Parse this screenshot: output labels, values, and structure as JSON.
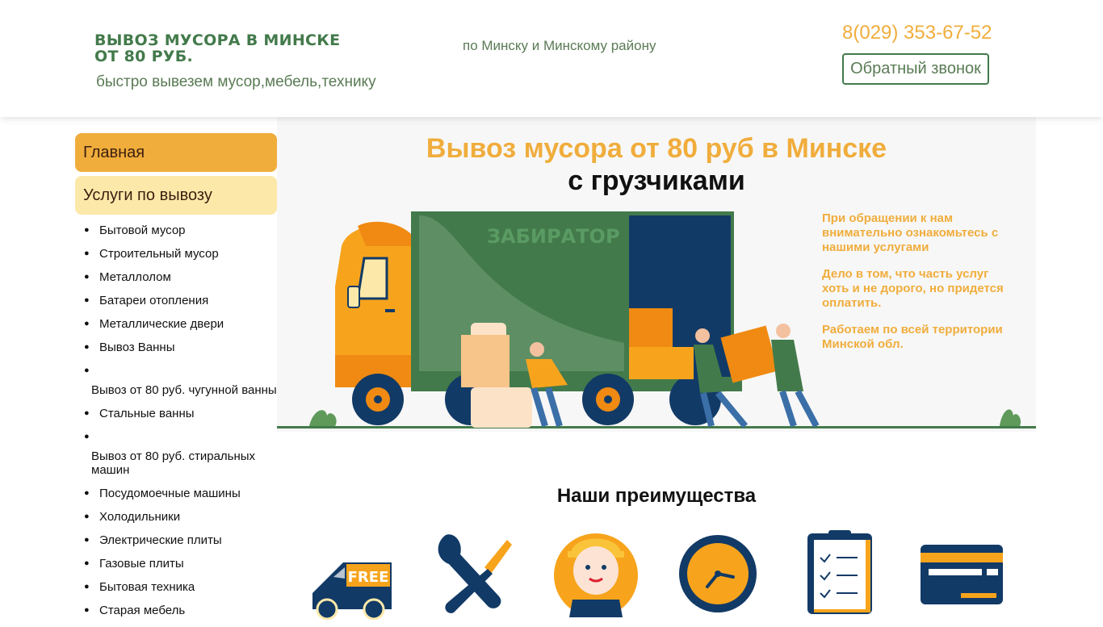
{
  "header": {
    "logo_line1": "ВЫВОЗ МУСОРА В МИНСКЕ",
    "logo_line2": "ОТ 80 РУБ.",
    "tagline": "быстро вывезем мусор,мебель,технику",
    "region": "по Минску и Минскому району",
    "phone": "8(029) 353-67-52",
    "callback_label": "Обратный звонок"
  },
  "sidebar": {
    "home_label": "Главная",
    "services_label": "Услуги по вывозу",
    "items": [
      "Бытовой мусор",
      "Строительный мусор",
      "Металлолом",
      "Батареи отопления",
      "Металлические двери",
      "Вывоз Ванны",
      "Вывоз от 80 руб. чугунной ванны",
      "Стальные ванны",
      "Вывоз от 80 руб. стиральных машин",
      "Посудомоечные машины",
      "Холодильники",
      "Электрические плиты",
      "Газовые плиты",
      "Бытовая техника",
      "Старая мебель"
    ]
  },
  "hero": {
    "title": "Вывоз мусора от 80 руб в Минске",
    "subtitle": "с  грузчиками",
    "truck_brand": "ЗАБИРАТОР",
    "notes": [
      "При обращении к нам внимательно ознакомьтесь с нашими услугами",
      "Дело в том, что часть услуг хоть и не дорого, но придется оплатить.",
      "Работаем по всей территории Минской обл."
    ]
  },
  "advantages": {
    "title": "Наши преимущества",
    "free_badge": "FREE",
    "icons": [
      "free-truck-icon",
      "tools-icon",
      "worker-icon",
      "clock-icon",
      "clipboard-icon",
      "card-icon"
    ]
  },
  "colors": {
    "green": "#437a4b",
    "orange": "#f0ad3c",
    "light_yellow": "#fce9aa",
    "navy": "#123a66"
  }
}
